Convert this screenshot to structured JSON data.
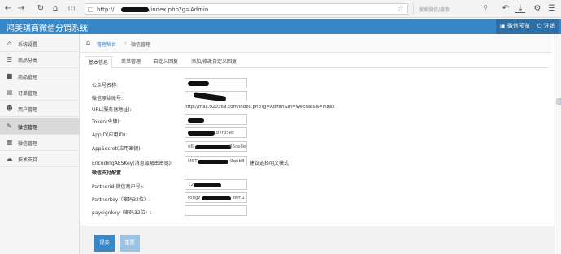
{
  "browser": {
    "url": "http://",
    "url_suffix": "n/index.php?g=Admin",
    "search_placeholder": "搜索微信/搜索",
    "icons": [
      "back-icon",
      "forward-icon",
      "reload-icon",
      "home-icon",
      "book-icon",
      "star-icon",
      "undo-icon",
      "download-icon",
      "settings-icon",
      "menu-icon"
    ]
  },
  "header": {
    "title": "鸿美琪商微信分销系统",
    "preview_label": "微信预览",
    "logout_label": "注销"
  },
  "sidebar": {
    "items": [
      {
        "label": "系统设置",
        "icon": "home-icon"
      },
      {
        "label": "商品分类",
        "icon": "list-icon"
      },
      {
        "label": "商品管理",
        "icon": "box-icon"
      },
      {
        "label": "订单管理",
        "icon": "order-icon"
      },
      {
        "label": "用户管理",
        "icon": "user-icon"
      },
      {
        "label": "微信管理",
        "icon": "edit-icon",
        "active": true
      },
      {
        "label": "微信管理",
        "icon": "chart-icon"
      },
      {
        "label": "技术支持",
        "icon": "cloud-icon"
      }
    ]
  },
  "breadcrumb": {
    "root": "管理后台",
    "current": "微信管理"
  },
  "tabs": [
    {
      "label": "基本信息",
      "active": true
    },
    {
      "label": "菜单管理"
    },
    {
      "label": "自定义回复"
    },
    {
      "label": "添加/修改自定义回复"
    }
  ],
  "form": {
    "fields": [
      {
        "label": "公众号名称:",
        "value": ""
      },
      {
        "label": "微信原始账号:",
        "value": ""
      },
      {
        "label": "URL(服务器地址):",
        "value": "http://mall.020369.com/index.php?g=Admin&m=Wechat&a=index"
      },
      {
        "label": "Token(令牌):",
        "value": ""
      },
      {
        "label": "AppID(应用ID):",
        "value": "a187f85ec"
      },
      {
        "label": "AppSecret(应用密钥):",
        "value": "e6",
        "value_end": "86ce8e"
      },
      {
        "label": "EncodingAESKey(消息加解密密钥):",
        "value": "MST",
        "value_end": "9qub8",
        "hint": "建议选择明文模式"
      }
    ],
    "pay_section_title": "微信支付配置",
    "pay_fields": [
      {
        "label": "Partnerid(微信商户号):",
        "value": "12"
      },
      {
        "label": "Partnerkey（密码32位）:",
        "value": "tongz",
        "value_end": "zkm1"
      },
      {
        "label": "paysignkey（密码32位）:",
        "value": ""
      }
    ]
  },
  "actions": {
    "submit_label": "提交",
    "reset_label": "重置"
  }
}
